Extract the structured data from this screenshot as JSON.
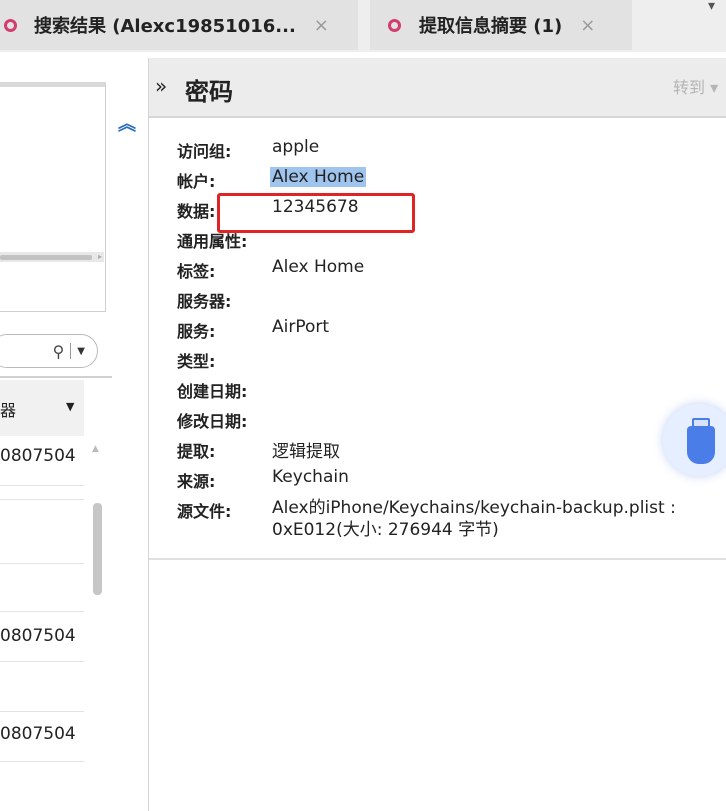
{
  "tabs": [
    {
      "label": "搜索结果 (Alexc19851016...",
      "close": "×"
    },
    {
      "label": "提取信息摘要 (1)",
      "close": "×"
    }
  ],
  "tab_menu_icon": "chevron-down-icon",
  "left_panel": {
    "collapse_icon": "double-chevron-up-icon",
    "search_icon": "search-icon",
    "column_header": "器",
    "rows": [
      "0807504",
      "",
      "",
      "0807504",
      "",
      "0807504"
    ]
  },
  "detail": {
    "title": "密码",
    "expand_icon": "»",
    "goto_label": "转到",
    "fields": [
      {
        "label": "访问组:",
        "value": "apple"
      },
      {
        "label": "帐户:",
        "value": "Alex Home"
      },
      {
        "label": "数据:",
        "value": "12345678"
      },
      {
        "label": "通用属性:",
        "value": ""
      },
      {
        "label": "标签:",
        "value": "Alex Home"
      },
      {
        "label": "服务器:",
        "value": ""
      },
      {
        "label": "服务:",
        "value": "AirPort"
      },
      {
        "label": "类型:",
        "value": ""
      },
      {
        "label": "创建日期:",
        "value": ""
      },
      {
        "label": "修改日期:",
        "value": ""
      },
      {
        "label": "提取:",
        "value": "逻辑提取"
      },
      {
        "label": "来源:",
        "value": "Keychain"
      },
      {
        "label": "源文件:",
        "value": "Alex的iPhone/Keychains/keychain-backup.plist : 0xE012(大小: 276944 字节)"
      }
    ]
  },
  "colors": {
    "tab_icon": "#d23c6e",
    "highlight": "#9fc4ee",
    "red_box": "#e02424",
    "usb_blue": "#4a7de8"
  }
}
